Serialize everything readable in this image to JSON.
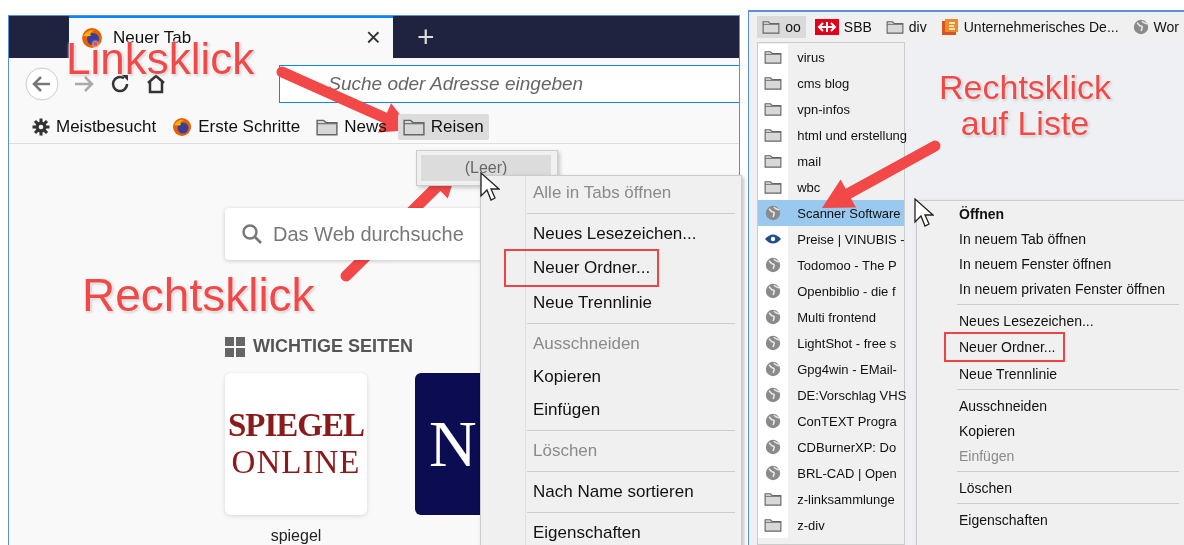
{
  "left_window": {
    "tab": {
      "title": "Neuer Tab",
      "close": "×"
    },
    "new_tab": "+",
    "url_placeholder": "Suche oder Adresse eingeben",
    "bookmarks": [
      {
        "kind": "gear",
        "label": "Meistbesucht",
        "open": false
      },
      {
        "kind": "firefox",
        "label": "Erste Schritte",
        "open": false
      },
      {
        "kind": "folder",
        "label": "News",
        "open": false
      },
      {
        "kind": "folder",
        "label": "Reisen",
        "open": true
      }
    ],
    "folder_popup": {
      "label": "(Leer)"
    },
    "search_placeholder": "Das Web durchsuche",
    "top_sites_heading": "WICHTIGE SEITEN",
    "tiles": [
      {
        "kind": "spiegel",
        "logo_line_1": "SPIEGEL",
        "logo_line_2": "ONLINE",
        "label": "spiegel"
      },
      {
        "kind": "nzz",
        "logo_line_1": "N"
      }
    ],
    "context_menu": [
      {
        "kind": "item",
        "label": "Alle in Tabs öffnen",
        "disabled": true,
        "outlined": false,
        "default": false
      },
      {
        "kind": "separator"
      },
      {
        "kind": "item",
        "label": "Neues Lesezeichen...",
        "disabled": false,
        "outlined": false,
        "default": false
      },
      {
        "kind": "item",
        "label": "Neuer Ordner...",
        "disabled": false,
        "outlined": true,
        "default": false
      },
      {
        "kind": "item",
        "label": "Neue Trennlinie",
        "disabled": false,
        "outlined": false,
        "default": false
      },
      {
        "kind": "separator"
      },
      {
        "kind": "item",
        "label": "Ausschneiden",
        "disabled": true,
        "outlined": false,
        "default": false
      },
      {
        "kind": "item",
        "label": "Kopieren",
        "disabled": false,
        "outlined": false,
        "default": false
      },
      {
        "kind": "item",
        "label": "Einfügen",
        "disabled": false,
        "outlined": false,
        "default": false
      },
      {
        "kind": "separator"
      },
      {
        "kind": "item",
        "label": "Löschen",
        "disabled": true,
        "outlined": false,
        "default": false
      },
      {
        "kind": "separator"
      },
      {
        "kind": "item",
        "label": "Nach Name sortieren",
        "disabled": false,
        "outlined": false,
        "default": false
      },
      {
        "kind": "separator"
      },
      {
        "kind": "item",
        "label": "Eigenschaften",
        "disabled": false,
        "outlined": false,
        "default": false
      }
    ]
  },
  "right_window": {
    "bookmarks": [
      {
        "kind": "folder",
        "label": "oo",
        "open": true
      },
      {
        "kind": "sbb",
        "label": "SBB",
        "open": false
      },
      {
        "kind": "folder",
        "label": "div",
        "open": false
      },
      {
        "kind": "app",
        "label": "Unternehmerisches De...",
        "open": false
      },
      {
        "kind": "globe",
        "label": "Wor",
        "open": false
      }
    ],
    "folder_items": [
      {
        "kind": "folder",
        "label": "virus",
        "selected": false
      },
      {
        "kind": "folder",
        "label": "cms blog",
        "selected": false
      },
      {
        "kind": "folder",
        "label": "vpn-infos",
        "selected": false
      },
      {
        "kind": "folder",
        "label": "html und erstellung",
        "selected": false
      },
      {
        "kind": "folder",
        "label": "mail",
        "selected": false
      },
      {
        "kind": "folder",
        "label": "wbc",
        "selected": false
      },
      {
        "kind": "globe",
        "label": "Scanner Software",
        "selected": true
      },
      {
        "kind": "eye",
        "label": "Preise | VINUBIS -",
        "selected": false
      },
      {
        "kind": "globe",
        "label": "Todomoo - The P",
        "selected": false
      },
      {
        "kind": "globe",
        "label": "Openbiblio - die f",
        "selected": false
      },
      {
        "kind": "globe",
        "label": "Multi frontend",
        "selected": false
      },
      {
        "kind": "globe",
        "label": "LightShot - free s",
        "selected": false
      },
      {
        "kind": "globe",
        "label": "Gpg4win - EMail-",
        "selected": false
      },
      {
        "kind": "globe",
        "label": "DE:Vorschlag VHS",
        "selected": false
      },
      {
        "kind": "globe",
        "label": "ConTEXT Progra",
        "selected": false
      },
      {
        "kind": "globe",
        "label": "CDBurnerXP: Do",
        "selected": false
      },
      {
        "kind": "globe",
        "label": "BRL-CAD | Open",
        "selected": false
      },
      {
        "kind": "folder",
        "label": "z-linksammlunge",
        "selected": false
      },
      {
        "kind": "folder",
        "label": "z-div",
        "selected": false
      }
    ],
    "context_menu": [
      {
        "kind": "item",
        "label": "Öffnen",
        "disabled": false,
        "outlined": false,
        "default": true
      },
      {
        "kind": "item",
        "label": "In neuem Tab öffnen",
        "disabled": false,
        "outlined": false,
        "default": false
      },
      {
        "kind": "item",
        "label": "In neuem Fenster öffnen",
        "disabled": false,
        "outlined": false,
        "default": false
      },
      {
        "kind": "item",
        "label": "In neuem privaten Fenster öffnen",
        "disabled": false,
        "outlined": false,
        "default": false
      },
      {
        "kind": "separator"
      },
      {
        "kind": "item",
        "label": "Neues Lesezeichen...",
        "disabled": false,
        "outlined": false,
        "default": false
      },
      {
        "kind": "item",
        "label": "Neuer Ordner...",
        "disabled": false,
        "outlined": true,
        "default": false
      },
      {
        "kind": "item",
        "label": "Neue Trennlinie",
        "disabled": false,
        "outlined": false,
        "default": false
      },
      {
        "kind": "separator"
      },
      {
        "kind": "item",
        "label": "Ausschneiden",
        "disabled": false,
        "outlined": false,
        "default": false
      },
      {
        "kind": "item",
        "label": "Kopieren",
        "disabled": false,
        "outlined": false,
        "default": false
      },
      {
        "kind": "item",
        "label": "Einfügen",
        "disabled": true,
        "outlined": false,
        "default": false
      },
      {
        "kind": "separator"
      },
      {
        "kind": "item",
        "label": "Löschen",
        "disabled": false,
        "outlined": false,
        "default": false
      },
      {
        "kind": "separator"
      },
      {
        "kind": "item",
        "label": "Eigenschaften",
        "disabled": false,
        "outlined": false,
        "default": false
      }
    ]
  },
  "annotations": [
    {
      "text": "Linksklick"
    },
    {
      "text": "Rechtsklick"
    },
    {
      "text": "Rechtsklick auf Liste"
    }
  ]
}
